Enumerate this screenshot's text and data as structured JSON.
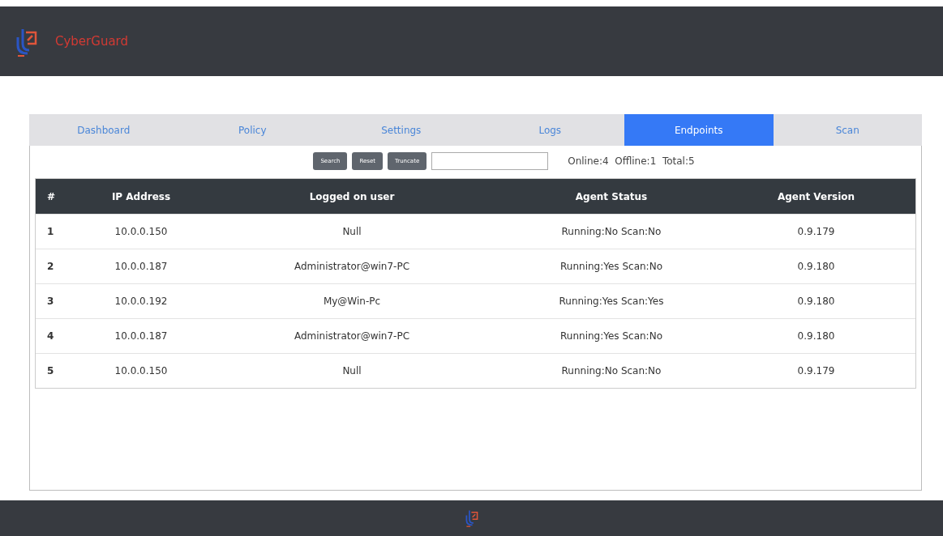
{
  "header": {
    "brand": "CyberGuard"
  },
  "tabs": [
    {
      "label": "Dashboard",
      "selected": false
    },
    {
      "label": "Policy",
      "selected": false
    },
    {
      "label": "Settings",
      "selected": false
    },
    {
      "label": "Logs",
      "selected": false
    },
    {
      "label": "Endpoints",
      "selected": true
    },
    {
      "label": "Scan",
      "selected": false
    }
  ],
  "toolbar": {
    "buttons": [
      "Search",
      "Reset",
      "Truncate"
    ],
    "summary": "Online:4  Offline:1  Total:5"
  },
  "table": {
    "columns": [
      "#",
      "IP Address",
      "Logged on user",
      "Agent Status",
      "Agent Version"
    ],
    "rows": [
      [
        "1",
        "10.0.0.150",
        "Null",
        "Running:No Scan:No",
        "0.9.179"
      ],
      [
        "2",
        "10.0.0.187",
        "Administrator@win7-PC",
        "Running:Yes Scan:No",
        "0.9.180"
      ],
      [
        "3",
        "10.0.0.192",
        "My@Win-Pc",
        "Running:Yes Scan:Yes",
        "0.9.180"
      ],
      [
        "4",
        "10.0.0.187",
        "Administrator@win7-PC",
        "Running:Yes Scan:No",
        "0.9.180"
      ],
      [
        "5",
        "10.0.0.150",
        "Null",
        "Running:No Scan:No",
        "0.9.179"
      ]
    ]
  }
}
